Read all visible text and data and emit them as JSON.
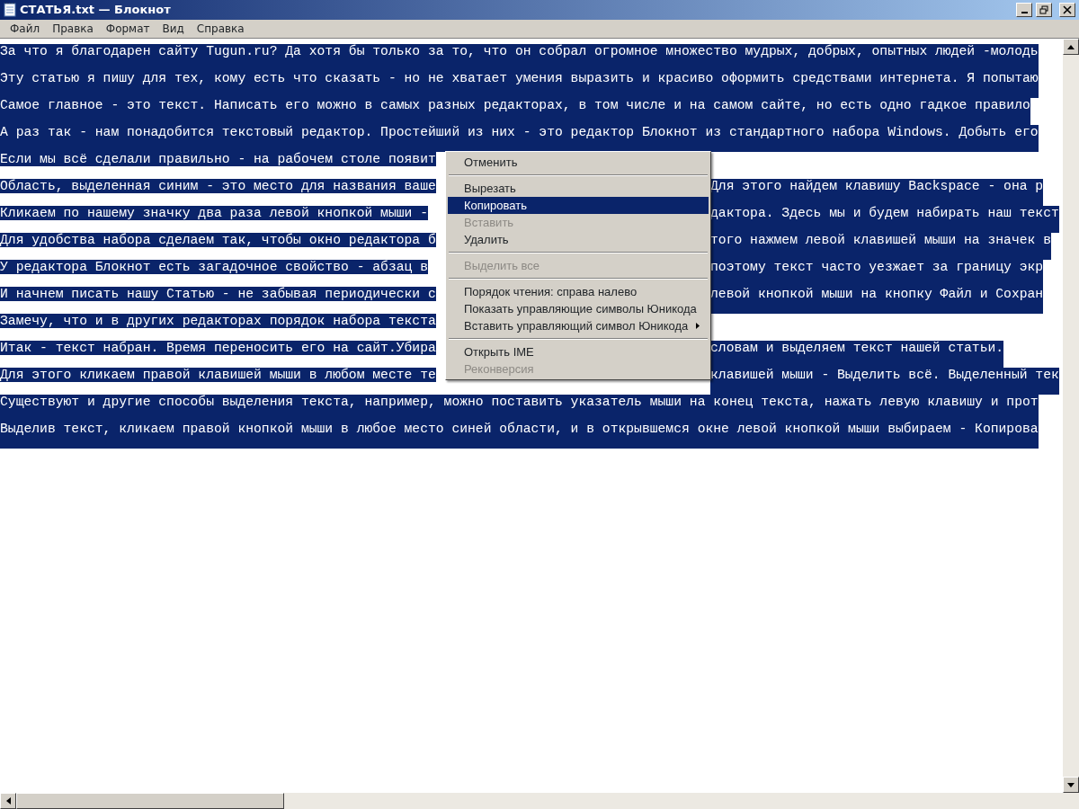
{
  "window": {
    "title": "СТАТЬЯ.txt — Блокнот"
  },
  "menu_bar": [
    {
      "label": "Файл"
    },
    {
      "label": "Правка"
    },
    {
      "label": "Формат"
    },
    {
      "label": "Вид"
    },
    {
      "label": "Справка"
    }
  ],
  "lines": [
    {
      "kind": "full",
      "selected": true,
      "text": "За что я благодарен сайту Tugun.ru? Да хотя бы только за то, что он собрал огромное множество мудрых, добрых, опытных людей -молодь"
    },
    {
      "kind": "full",
      "selected": true,
      "text": "Эту статью я пишу для тех, кому есть что сказать - но не хватает умения выразить и красиво оформить средствами интернета. Я попытаю"
    },
    {
      "kind": "full",
      "selected": true,
      "text": "Самое главное - это текст. Написать его можно в самых разных редакторах, в том числе и на самом сайте, но есть одно гадкое правило"
    },
    {
      "kind": "full",
      "selected": true,
      "text": "А раз так - нам понадобится текстовый редактор. Простейший из них - это редактор Блокнот из стандартного набора Windows. Добыть его"
    },
    {
      "kind": "split",
      "selected": true,
      "left": "Если мы всё сделали правильно - на рабочем столе появит"
    },
    {
      "kind": "split",
      "selected": true,
      "left": "Область, выделенная синим - это место для названия ваше",
      "right": "Для этого найдем клавишу Backspace - она р"
    },
    {
      "kind": "split",
      "selected": true,
      "left": "Кликаем по нашему значку два раза левой кнопкой мыши -",
      "right": "дактора. Здесь мы и будем набирать наш текст"
    },
    {
      "kind": "split",
      "selected": true,
      "left": "Для удобства набора сделаем так, чтобы окно редактора б",
      "right": "того нажмем левой клавишей мыши на значек в"
    },
    {
      "kind": "split",
      "selected": true,
      "left": "У редактора Блокнот есть загадочное свойство - абзац в",
      "right": "поэтому текст часто уезжает за границу экр"
    },
    {
      "kind": "split",
      "selected": true,
      "left": "И начнем писать нашу Статью - не забывая периодически с",
      "right": "левой кнопкой мыши на кнопку Файл и Сохран"
    },
    {
      "kind": "split",
      "selected": true,
      "left": "Замечу, что и в других редакторах порядок набора текста"
    },
    {
      "kind": "split",
      "selected": true,
      "left": "Итак - текст набран. Время переносить его на сайт.Убира",
      "right": "словам и выделяем текст нашей статьи."
    },
    {
      "kind": "split",
      "selected": true,
      "left": "Для этого кликаем правой клавишей мыши в любом месте те",
      "right": "клавишей мыши - Выделить всё. Выделенный тек"
    },
    {
      "kind": "full",
      "selected": true,
      "text": "Существуют и другие способы выделения текста, например, можно поставить указатель мыши на конец текста, нажать левую клавишу и прот"
    },
    {
      "kind": "full",
      "selected": true,
      "text": "Выделив текст, кликаем правой кнопкой мыши в любое место синей области, и в открывшемся окне левой кнопкой мыши выбираем - Копирова"
    }
  ],
  "context_menu": {
    "items": [
      {
        "kind": "item",
        "label": "Отменить",
        "disabled": false,
        "selected": false,
        "submenu": false
      },
      {
        "kind": "separator"
      },
      {
        "kind": "item",
        "label": "Вырезать",
        "disabled": false,
        "selected": false,
        "submenu": false
      },
      {
        "kind": "item",
        "label": "Копировать",
        "disabled": false,
        "selected": true,
        "submenu": false
      },
      {
        "kind": "item",
        "label": "Вставить",
        "disabled": true,
        "selected": false,
        "submenu": false
      },
      {
        "kind": "item",
        "label": "Удалить",
        "disabled": false,
        "selected": false,
        "submenu": false
      },
      {
        "kind": "separator"
      },
      {
        "kind": "item",
        "label": "Выделить все",
        "disabled": true,
        "selected": false,
        "submenu": false
      },
      {
        "kind": "separator"
      },
      {
        "kind": "item",
        "label": "Порядок чтения: справа налево",
        "disabled": false,
        "selected": false,
        "submenu": false
      },
      {
        "kind": "item",
        "label": "Показать управляющие символы Юникода",
        "disabled": false,
        "selected": false,
        "submenu": false
      },
      {
        "kind": "item",
        "label": "Вставить управляющий символ Юникода",
        "disabled": false,
        "selected": false,
        "submenu": true
      },
      {
        "kind": "separator"
      },
      {
        "kind": "item",
        "label": "Открыть IME",
        "disabled": false,
        "selected": false,
        "submenu": false
      },
      {
        "kind": "item",
        "label": "Реконверсия",
        "disabled": true,
        "selected": false,
        "submenu": false
      }
    ]
  }
}
